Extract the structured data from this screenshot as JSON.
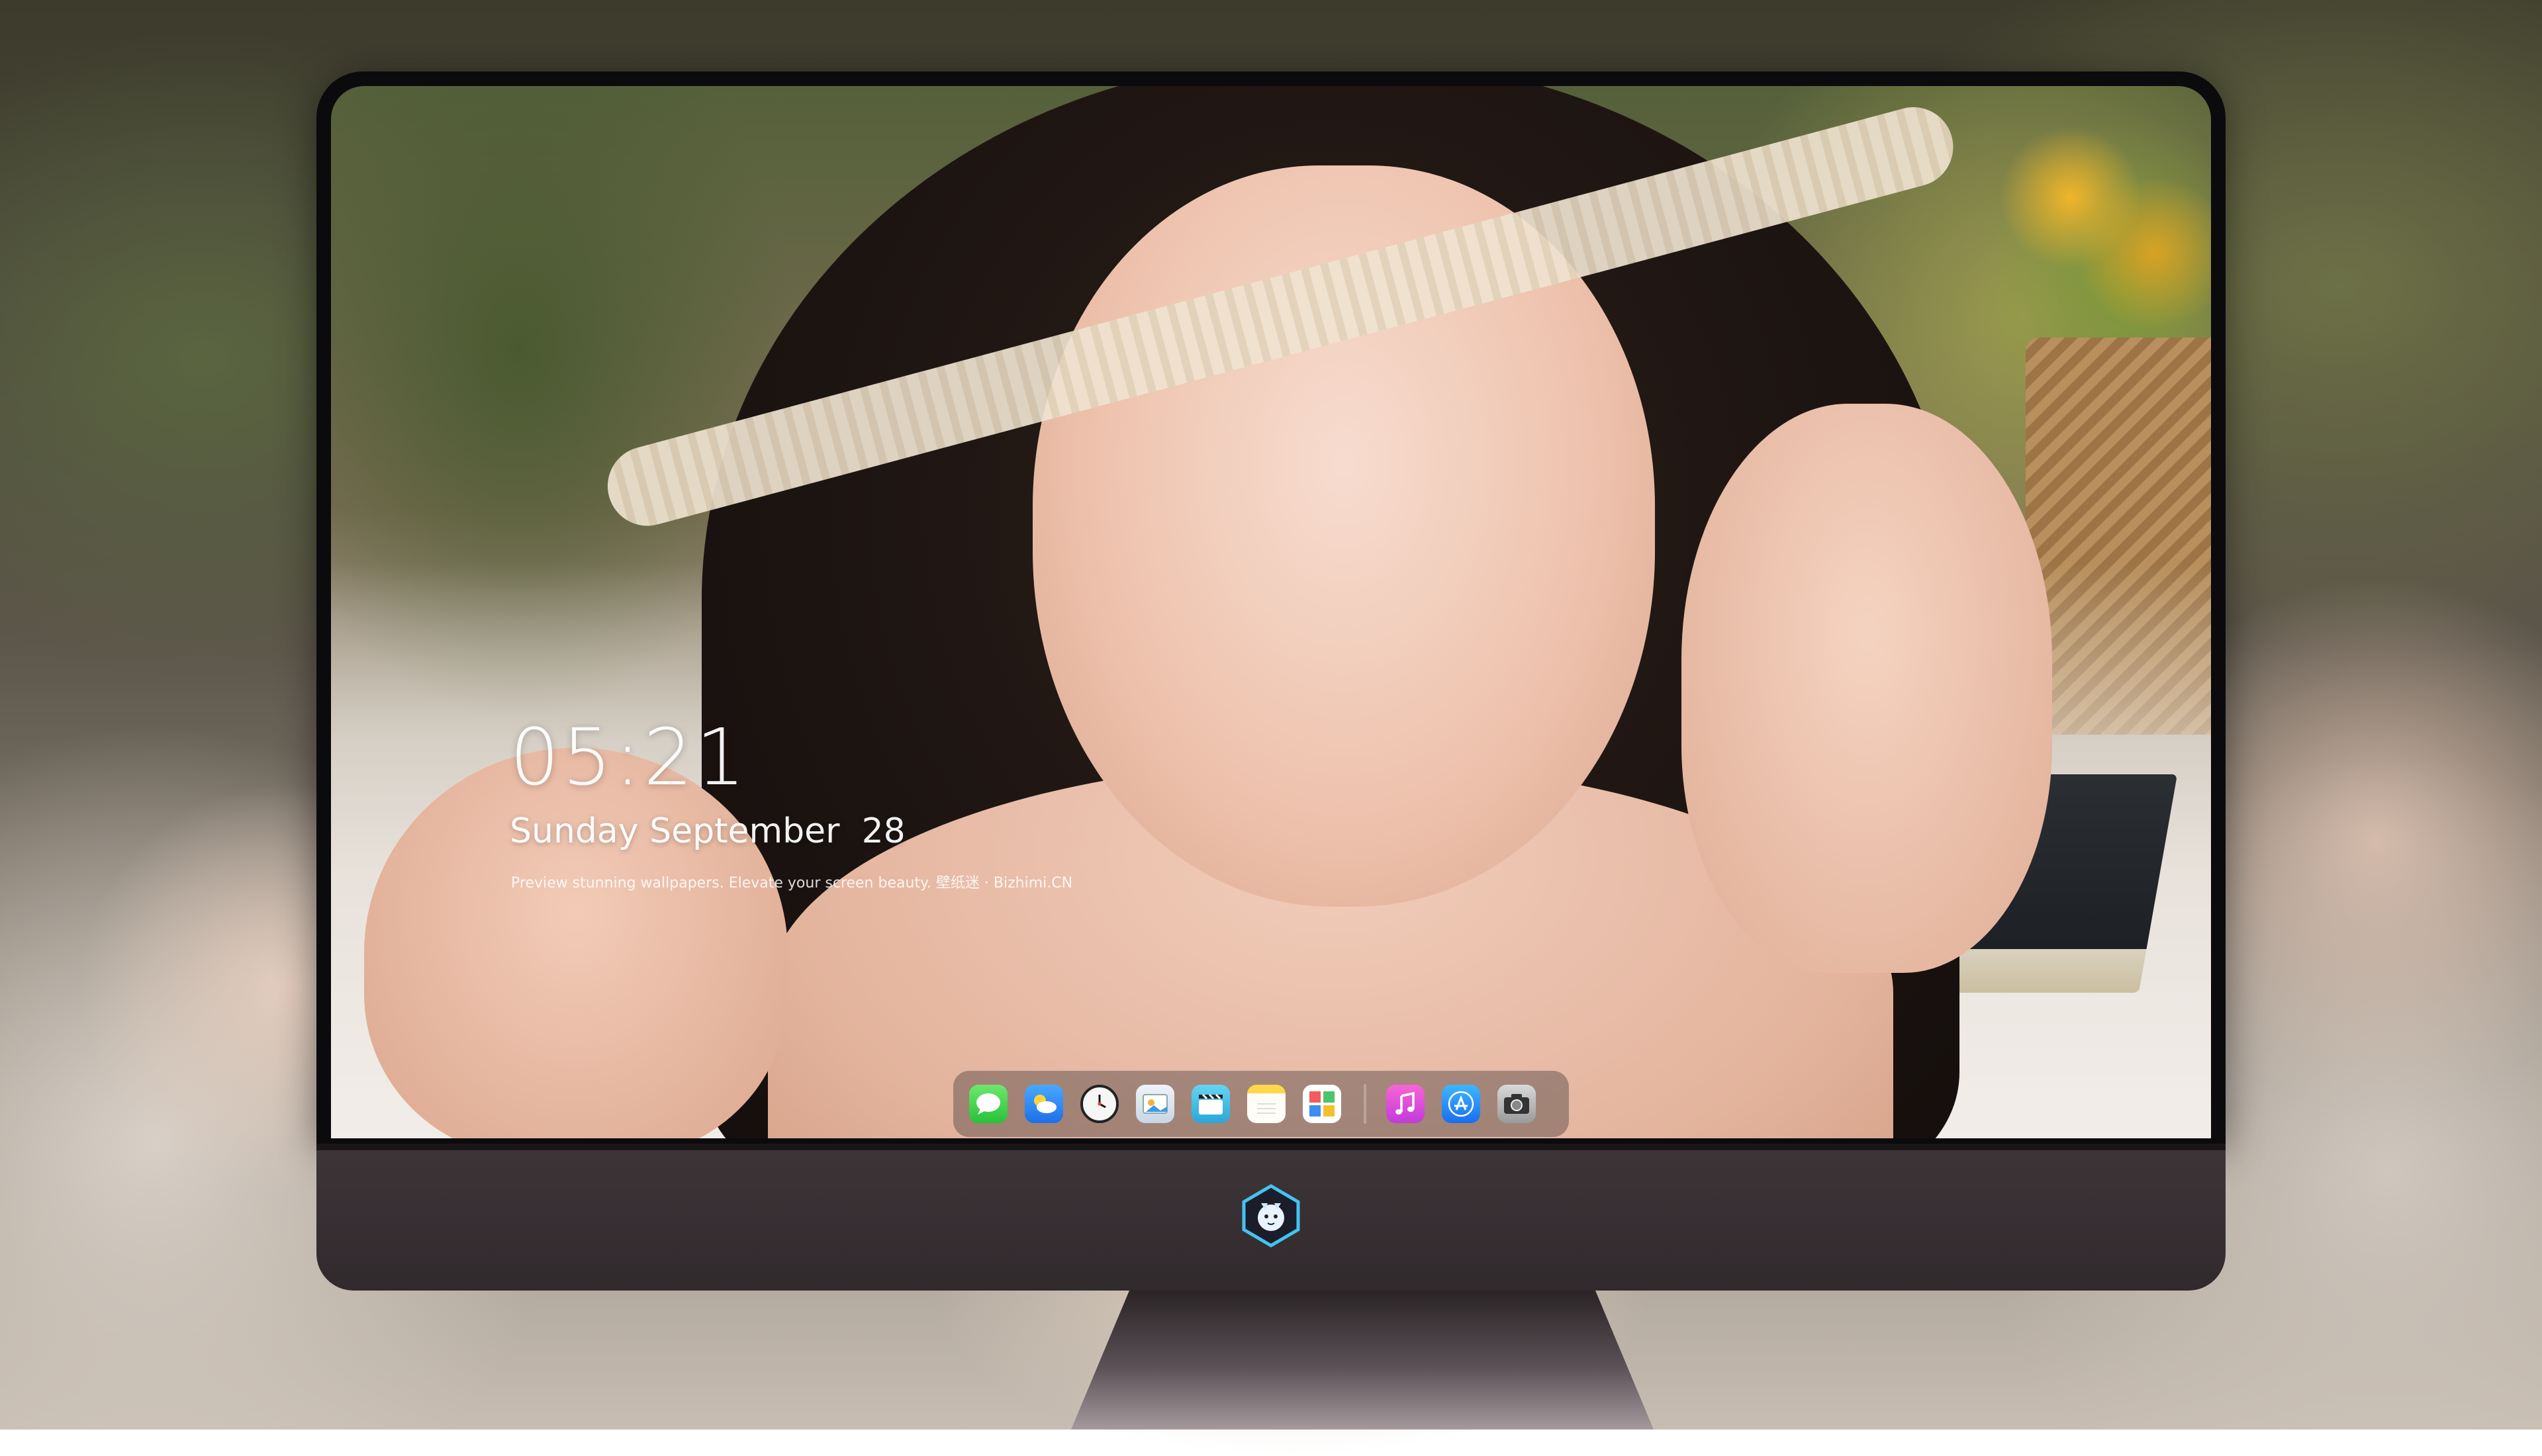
{
  "lockscreen": {
    "time": "05:21",
    "date": "Sunday September  28",
    "tagline": "Preview stunning wallpapers. Elevate your screen beauty. 壁纸迷 · Bizhimi.CN"
  },
  "dock": {
    "apps": [
      {
        "name": "Messages",
        "icon": "messages-icon"
      },
      {
        "name": "Weather",
        "icon": "weather-icon"
      },
      {
        "name": "Clock",
        "icon": "clock-icon"
      },
      {
        "name": "Preview",
        "icon": "preview-icon"
      },
      {
        "name": "Claquette",
        "icon": "clapperboard-icon"
      },
      {
        "name": "Notes",
        "icon": "notes-icon"
      },
      {
        "name": "Photo Booth",
        "icon": "photos-icon"
      },
      {
        "name": "Music",
        "icon": "music-icon"
      },
      {
        "name": "App Store",
        "icon": "appstore-icon"
      },
      {
        "name": "Screenshot",
        "icon": "camera-icon"
      }
    ]
  },
  "colors": {
    "monitor_chin": "#3d3438",
    "bezel": "#0b0a0c",
    "dock_bg": "rgba(70,60,60,0.42)"
  }
}
